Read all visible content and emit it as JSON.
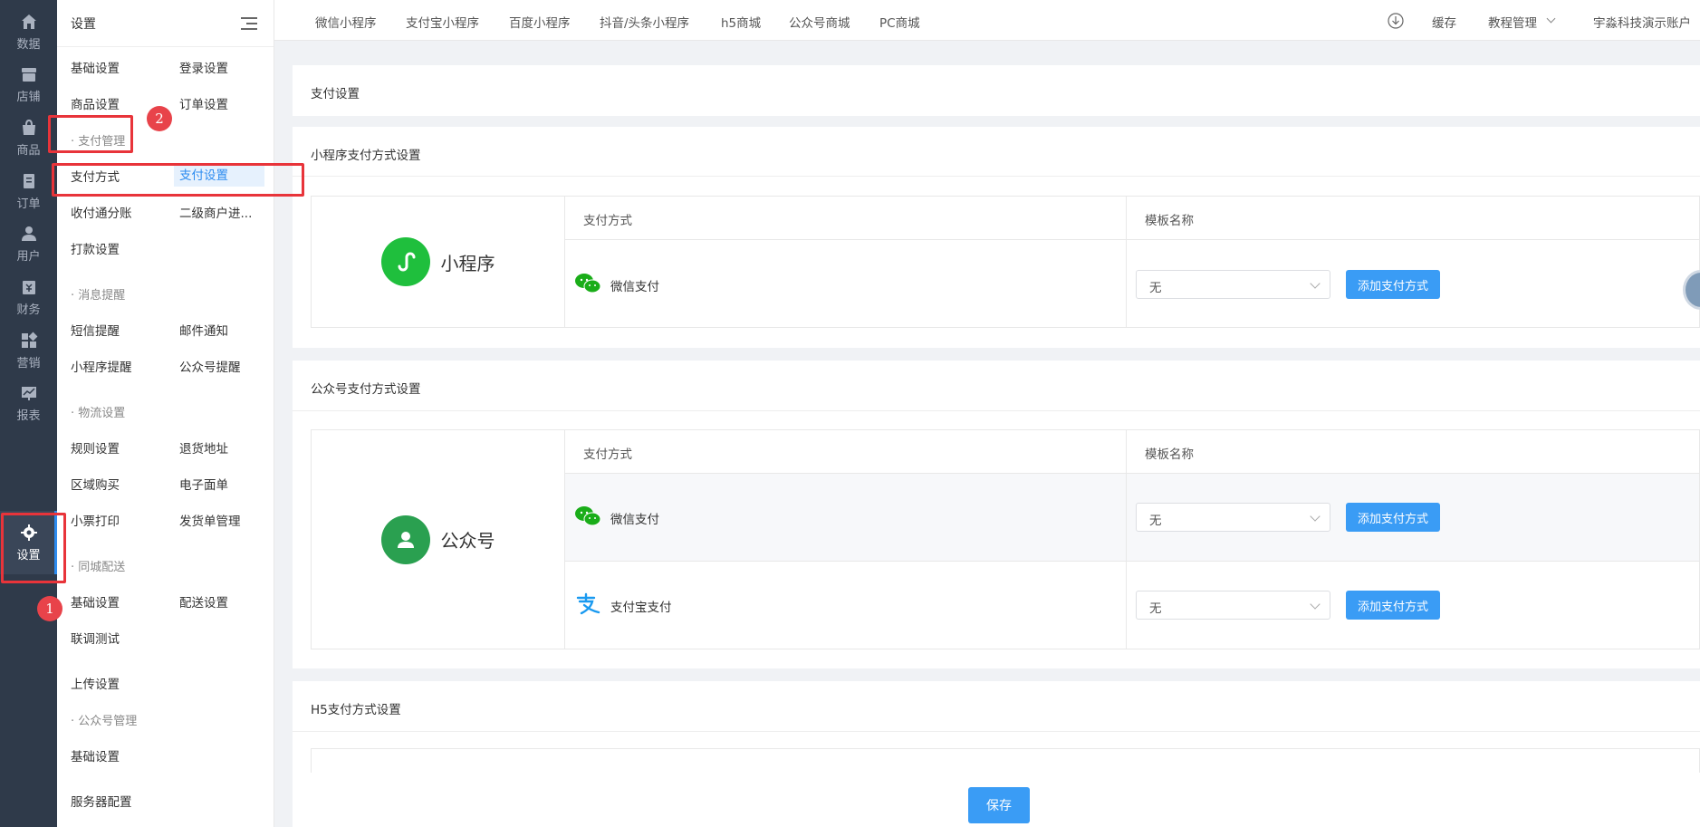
{
  "rail": {
    "items": [
      {
        "label": "数据",
        "icon": "home-icon"
      },
      {
        "label": "店铺",
        "icon": "store-icon"
      },
      {
        "label": "商品",
        "icon": "bag-icon"
      },
      {
        "label": "订单",
        "icon": "order-icon"
      },
      {
        "label": "用户",
        "icon": "user-icon"
      },
      {
        "label": "财务",
        "icon": "finance-icon"
      },
      {
        "label": "营销",
        "icon": "marketing-icon"
      },
      {
        "label": "报表",
        "icon": "report-icon"
      },
      {
        "label": "设置",
        "icon": "gear-icon",
        "active": true
      }
    ]
  },
  "sidebar": {
    "title": "设置",
    "items": {
      "basic": "基础设置",
      "login": "登录设置",
      "goods": "商品设置",
      "order": "订单设置",
      "pay_group": "· 支付管理",
      "pay_method": "支付方式",
      "pay_setting": "支付设置",
      "split": "收付通分账",
      "sub_merchant": "二级商户进...",
      "payout": "打款设置",
      "msg_group": "· 消息提醒",
      "sms": "短信提醒",
      "mail": "邮件通知",
      "mini_notice": "小程序提醒",
      "mp_notice": "公众号提醒",
      "logistics_group": "· 物流设置",
      "rule": "规则设置",
      "return_addr": "退货地址",
      "area_buy": "区域购买",
      "e_sheet": "电子面单",
      "ticket_print": "小票打印",
      "ship_manage": "发货单管理",
      "city_group": "· 同城配送",
      "city_basic": "基础设置",
      "delivery": "配送设置",
      "debug": "联调测试",
      "upload": "上传设置",
      "mp_group": "· 公众号管理",
      "mp_basic": "基础设置",
      "server": "服务器配置"
    }
  },
  "topbar": {
    "tabs": [
      "微信小程序",
      "支付宝小程序",
      "百度小程序",
      "抖音/头条小程序",
      "h5商城",
      "公众号商城",
      "PC商城"
    ],
    "cache": "缓存",
    "tutorial": "教程管理",
    "account": "宇淼科技演示账户"
  },
  "page": {
    "title": "支付设置",
    "mini": {
      "title": "小程序支付方式设置",
      "brand": "小程序",
      "col_method": "支付方式",
      "col_template": "模板名称",
      "rows": [
        {
          "method": "微信支付",
          "template": "无",
          "button": "添加支付方式"
        }
      ]
    },
    "mp": {
      "title": "公众号支付方式设置",
      "brand": "公众号",
      "col_method": "支付方式",
      "col_template": "模板名称",
      "rows": [
        {
          "method": "微信支付",
          "template": "无",
          "button": "添加支付方式"
        },
        {
          "method": "支付宝支付",
          "template": "无",
          "button": "添加支付方式"
        }
      ]
    },
    "h5": {
      "title": "H5支付方式设置"
    },
    "save": "保存"
  },
  "annotations": {
    "n1": "1",
    "n2": "2"
  },
  "colors": {
    "primary": "#3a9cf5",
    "rail_bg": "#2f3a4a",
    "annotation": "#e8343a"
  }
}
